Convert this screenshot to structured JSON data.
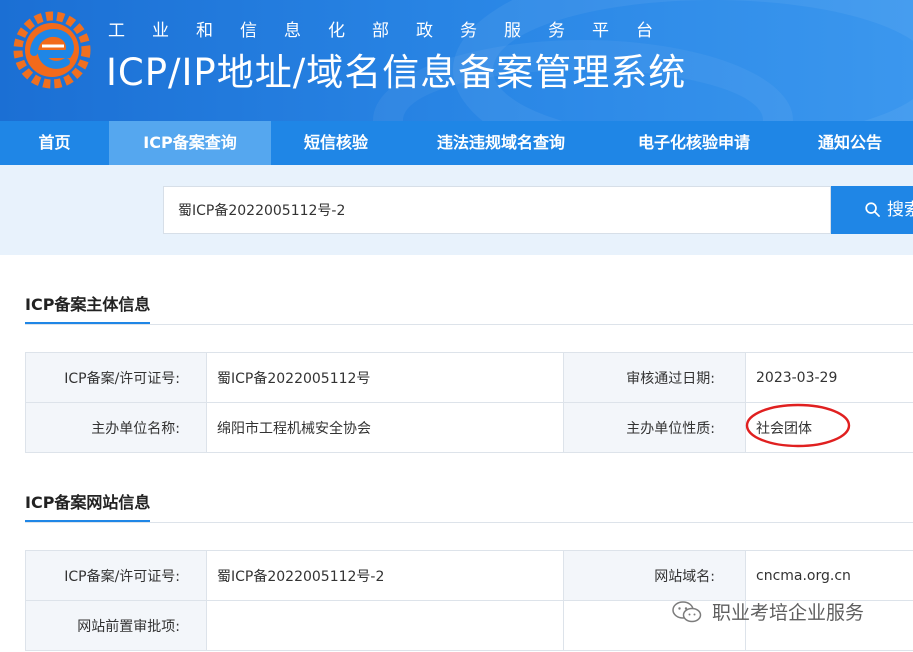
{
  "header": {
    "subtitle": "工业和信息化部政务服务平台",
    "title": "ICP/IP地址/域名信息备案管理系统"
  },
  "nav": {
    "items": [
      {
        "label": "首页",
        "active": false
      },
      {
        "label": "ICP备案查询",
        "active": true
      },
      {
        "label": "短信核验",
        "active": false
      },
      {
        "label": "违法违规域名查询",
        "active": false
      },
      {
        "label": "电子化核验申请",
        "active": false
      },
      {
        "label": "通知公告",
        "active": false
      }
    ]
  },
  "search": {
    "value": "蜀ICP备2022005112号-2",
    "button_label": "搜索"
  },
  "subject_section": {
    "title": "ICP备案主体信息",
    "rows": [
      {
        "label1": "ICP备案/许可证号:",
        "value1": "蜀ICP备2022005112号",
        "label2": "审核通过日期:",
        "value2": "2023-03-29"
      },
      {
        "label1": "主办单位名称:",
        "value1": "绵阳市工程机械安全协会",
        "label2": "主办单位性质:",
        "value2": "社会团体"
      }
    ]
  },
  "website_section": {
    "title": "ICP备案网站信息",
    "rows": [
      {
        "label1": "ICP备案/许可证号:",
        "value1": "蜀ICP备2022005112号-2",
        "label2": "网站域名:",
        "value2": "cncma.org.cn"
      },
      {
        "label1": "网站前置审批项:",
        "value1": "",
        "label2": "",
        "value2": ""
      }
    ]
  },
  "watermark": {
    "text": "职业考培企业服务"
  },
  "colors": {
    "primary": "#1f86e6",
    "nav_active": "#55a7ef",
    "highlight_circle": "#e02020"
  }
}
